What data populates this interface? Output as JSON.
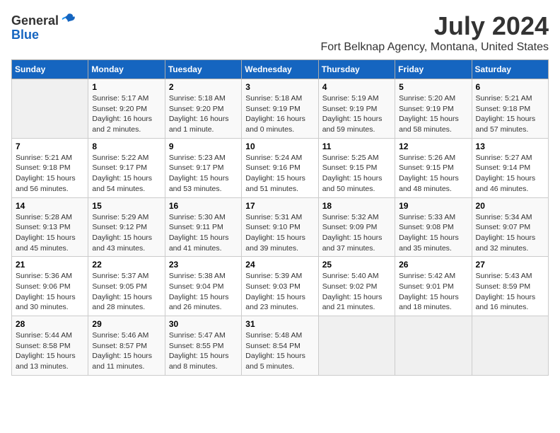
{
  "logo": {
    "general": "General",
    "blue": "Blue"
  },
  "title": "July 2024",
  "subtitle": "Fort Belknap Agency, Montana, United States",
  "days_of_week": [
    "Sunday",
    "Monday",
    "Tuesday",
    "Wednesday",
    "Thursday",
    "Friday",
    "Saturday"
  ],
  "weeks": [
    [
      {
        "day": "",
        "info": ""
      },
      {
        "day": "1",
        "info": "Sunrise: 5:17 AM\nSunset: 9:20 PM\nDaylight: 16 hours\nand 2 minutes."
      },
      {
        "day": "2",
        "info": "Sunrise: 5:18 AM\nSunset: 9:20 PM\nDaylight: 16 hours\nand 1 minute."
      },
      {
        "day": "3",
        "info": "Sunrise: 5:18 AM\nSunset: 9:19 PM\nDaylight: 16 hours\nand 0 minutes."
      },
      {
        "day": "4",
        "info": "Sunrise: 5:19 AM\nSunset: 9:19 PM\nDaylight: 15 hours\nand 59 minutes."
      },
      {
        "day": "5",
        "info": "Sunrise: 5:20 AM\nSunset: 9:19 PM\nDaylight: 15 hours\nand 58 minutes."
      },
      {
        "day": "6",
        "info": "Sunrise: 5:21 AM\nSunset: 9:18 PM\nDaylight: 15 hours\nand 57 minutes."
      }
    ],
    [
      {
        "day": "7",
        "info": "Sunrise: 5:21 AM\nSunset: 9:18 PM\nDaylight: 15 hours\nand 56 minutes."
      },
      {
        "day": "8",
        "info": "Sunrise: 5:22 AM\nSunset: 9:17 PM\nDaylight: 15 hours\nand 54 minutes."
      },
      {
        "day": "9",
        "info": "Sunrise: 5:23 AM\nSunset: 9:17 PM\nDaylight: 15 hours\nand 53 minutes."
      },
      {
        "day": "10",
        "info": "Sunrise: 5:24 AM\nSunset: 9:16 PM\nDaylight: 15 hours\nand 51 minutes."
      },
      {
        "day": "11",
        "info": "Sunrise: 5:25 AM\nSunset: 9:15 PM\nDaylight: 15 hours\nand 50 minutes."
      },
      {
        "day": "12",
        "info": "Sunrise: 5:26 AM\nSunset: 9:15 PM\nDaylight: 15 hours\nand 48 minutes."
      },
      {
        "day": "13",
        "info": "Sunrise: 5:27 AM\nSunset: 9:14 PM\nDaylight: 15 hours\nand 46 minutes."
      }
    ],
    [
      {
        "day": "14",
        "info": "Sunrise: 5:28 AM\nSunset: 9:13 PM\nDaylight: 15 hours\nand 45 minutes."
      },
      {
        "day": "15",
        "info": "Sunrise: 5:29 AM\nSunset: 9:12 PM\nDaylight: 15 hours\nand 43 minutes."
      },
      {
        "day": "16",
        "info": "Sunrise: 5:30 AM\nSunset: 9:11 PM\nDaylight: 15 hours\nand 41 minutes."
      },
      {
        "day": "17",
        "info": "Sunrise: 5:31 AM\nSunset: 9:10 PM\nDaylight: 15 hours\nand 39 minutes."
      },
      {
        "day": "18",
        "info": "Sunrise: 5:32 AM\nSunset: 9:09 PM\nDaylight: 15 hours\nand 37 minutes."
      },
      {
        "day": "19",
        "info": "Sunrise: 5:33 AM\nSunset: 9:08 PM\nDaylight: 15 hours\nand 35 minutes."
      },
      {
        "day": "20",
        "info": "Sunrise: 5:34 AM\nSunset: 9:07 PM\nDaylight: 15 hours\nand 32 minutes."
      }
    ],
    [
      {
        "day": "21",
        "info": "Sunrise: 5:36 AM\nSunset: 9:06 PM\nDaylight: 15 hours\nand 30 minutes."
      },
      {
        "day": "22",
        "info": "Sunrise: 5:37 AM\nSunset: 9:05 PM\nDaylight: 15 hours\nand 28 minutes."
      },
      {
        "day": "23",
        "info": "Sunrise: 5:38 AM\nSunset: 9:04 PM\nDaylight: 15 hours\nand 26 minutes."
      },
      {
        "day": "24",
        "info": "Sunrise: 5:39 AM\nSunset: 9:03 PM\nDaylight: 15 hours\nand 23 minutes."
      },
      {
        "day": "25",
        "info": "Sunrise: 5:40 AM\nSunset: 9:02 PM\nDaylight: 15 hours\nand 21 minutes."
      },
      {
        "day": "26",
        "info": "Sunrise: 5:42 AM\nSunset: 9:01 PM\nDaylight: 15 hours\nand 18 minutes."
      },
      {
        "day": "27",
        "info": "Sunrise: 5:43 AM\nSunset: 8:59 PM\nDaylight: 15 hours\nand 16 minutes."
      }
    ],
    [
      {
        "day": "28",
        "info": "Sunrise: 5:44 AM\nSunset: 8:58 PM\nDaylight: 15 hours\nand 13 minutes."
      },
      {
        "day": "29",
        "info": "Sunrise: 5:46 AM\nSunset: 8:57 PM\nDaylight: 15 hours\nand 11 minutes."
      },
      {
        "day": "30",
        "info": "Sunrise: 5:47 AM\nSunset: 8:55 PM\nDaylight: 15 hours\nand 8 minutes."
      },
      {
        "day": "31",
        "info": "Sunrise: 5:48 AM\nSunset: 8:54 PM\nDaylight: 15 hours\nand 5 minutes."
      },
      {
        "day": "",
        "info": ""
      },
      {
        "day": "",
        "info": ""
      },
      {
        "day": "",
        "info": ""
      }
    ]
  ]
}
